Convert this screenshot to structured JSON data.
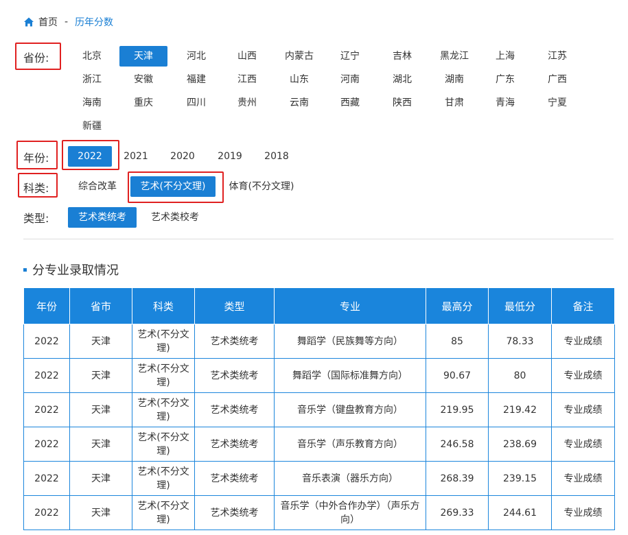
{
  "breadcrumb": {
    "home": "首页",
    "separator": "-",
    "current": "历年分数"
  },
  "filters": {
    "province_label": "省份:",
    "year_label": "年份:",
    "category_label": "科类:",
    "type_label": "类型:",
    "provinces": [
      "北京",
      "天津",
      "河北",
      "山西",
      "内蒙古",
      "辽宁",
      "吉林",
      "黑龙江",
      "上海",
      "江苏",
      "浙江",
      "安徽",
      "福建",
      "江西",
      "山东",
      "河南",
      "湖北",
      "湖南",
      "广东",
      "广西",
      "海南",
      "重庆",
      "四川",
      "贵州",
      "云南",
      "西藏",
      "陕西",
      "甘肃",
      "青海",
      "宁夏",
      "新疆"
    ],
    "selected_province": "天津",
    "years": [
      "2022",
      "2021",
      "2020",
      "2019",
      "2018"
    ],
    "selected_year": "2022",
    "categories": [
      "综合改革",
      "艺术(不分文理)",
      "体育(不分文理)"
    ],
    "selected_category": "艺术(不分文理)",
    "types": [
      "艺术类统考",
      "艺术类校考"
    ],
    "selected_type": "艺术类统考"
  },
  "section_title": "分专业录取情况",
  "table": {
    "headers": [
      "年份",
      "省市",
      "科类",
      "类型",
      "专业",
      "最高分",
      "最低分",
      "备注"
    ],
    "rows": [
      [
        "2022",
        "天津",
        "艺术(不分文理)",
        "艺术类统考",
        "舞蹈学（民族舞等方向）",
        "85",
        "78.33",
        "专业成绩"
      ],
      [
        "2022",
        "天津",
        "艺术(不分文理)",
        "艺术类统考",
        "舞蹈学（国际标准舞方向）",
        "90.67",
        "80",
        "专业成绩"
      ],
      [
        "2022",
        "天津",
        "艺术(不分文理)",
        "艺术类统考",
        "音乐学（键盘教育方向）",
        "219.95",
        "219.42",
        "专业成绩"
      ],
      [
        "2022",
        "天津",
        "艺术(不分文理)",
        "艺术类统考",
        "音乐学（声乐教育方向）",
        "246.58",
        "238.69",
        "专业成绩"
      ],
      [
        "2022",
        "天津",
        "艺术(不分文理)",
        "艺术类统考",
        "音乐表演（器乐方向）",
        "268.39",
        "239.15",
        "专业成绩"
      ],
      [
        "2022",
        "天津",
        "艺术(不分文理)",
        "艺术类统考",
        "音乐学（中外合作办学）（声乐方向）",
        "269.33",
        "244.61",
        "专业成绩"
      ]
    ]
  },
  "colors": {
    "accent": "#1a7fd4",
    "highlight_box": "#e02020"
  }
}
